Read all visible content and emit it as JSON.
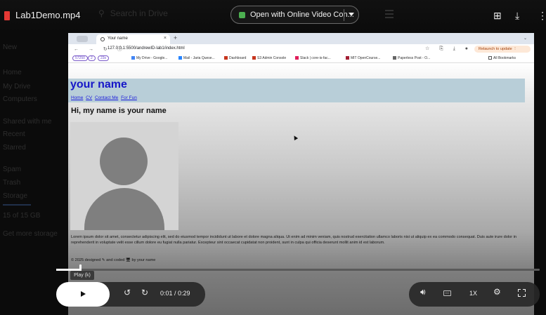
{
  "player": {
    "file_name": "Lab1Demo.mp4",
    "search_ghost": "Search in Drive",
    "open_with_label": "Open with Online Video Con...",
    "tooltip": "Play (k)",
    "time_display": "0:01 / 0:29",
    "progress": 0.048,
    "speed": "1X",
    "icons": [
      "play-icon",
      "replay-icon",
      "forward-icon",
      "volume-icon",
      "captions-icon",
      "settings-icon",
      "fullscreen-icon",
      "add-to-drive-icon",
      "download-icon",
      "more-vert-icon"
    ]
  },
  "ghost_sidebar": {
    "items": [
      "New",
      "Home",
      "My Drive",
      "Computers",
      "Shared with me",
      "Recent",
      "Starred",
      "Spam",
      "Trash",
      "Storage",
      "15 of 15 GB",
      "Get more storage"
    ]
  },
  "video_frame": {
    "browser": {
      "tab_title": "Your name",
      "url": "127.0.0.1:5500/andrewID-lab1/index.html",
      "relaunch_label": "Relaunch to update",
      "bookmark_pills": [
        "57250",
        "2",
        "23s"
      ],
      "bookmarks": [
        "My Drive - Google...",
        "Mail - Jaria Quese...",
        "Dashboard",
        "S3 Admin Console",
        "Slack | core-is-fac...",
        "MIT OpenCourse...",
        "Paperless Post - O...",
        "All Bookmarks"
      ]
    },
    "site": {
      "title": "your name",
      "nav": [
        "Home",
        "CV",
        "Contact Me",
        "For Fun"
      ],
      "greeting": "Hi, my name is your name",
      "lorem": "Lorem ipsum dolor sit amet, consectetur adipiscing elit, sed do eiusmod tempor incididunt ut labore et dolore magna aliqua. Ut enim ad minim veniam, quis nostrud exercitation ullamco laboris nisi ut aliquip ex ea commodo consequat. Duis aute irure dolor in reprehenderit in voluptate velit esse cillum dolore eu fugiat nulla pariatur. Excepteur sint occaecat cupidatat non proident, sunt in culpa qui officia deserunt mollit anim id est laborum.",
      "footer": "© 2025 designed ✎ and coded 🖥 by your name"
    }
  }
}
